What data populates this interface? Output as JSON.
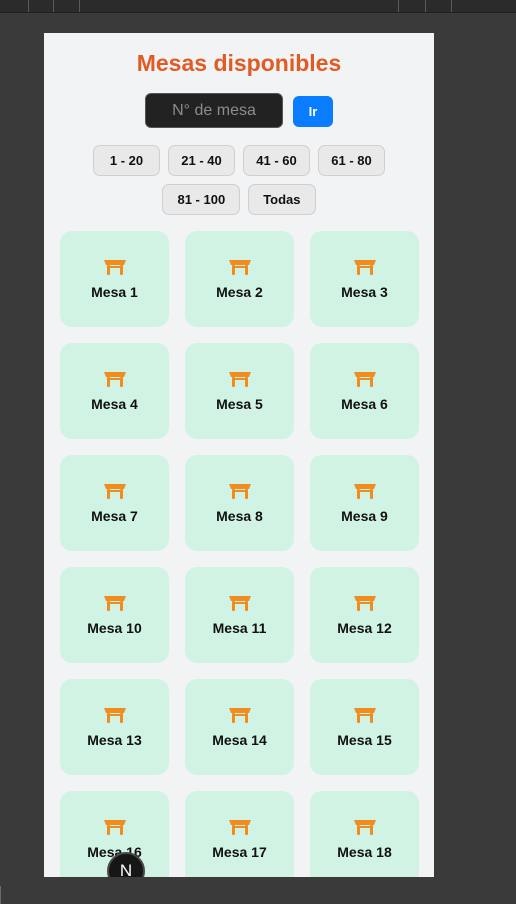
{
  "page": {
    "title": "Mesas disponibles",
    "search": {
      "placeholder": "N° de mesa",
      "value": ""
    },
    "go_label": "Ir"
  },
  "ranges": [
    "1 - 20",
    "21 - 40",
    "41 - 60",
    "61 - 80",
    "81 - 100",
    "Todas"
  ],
  "tables": [
    "Mesa 1",
    "Mesa 2",
    "Mesa 3",
    "Mesa 4",
    "Mesa 5",
    "Mesa 6",
    "Mesa 7",
    "Mesa 8",
    "Mesa 9",
    "Mesa 10",
    "Mesa 11",
    "Mesa 12",
    "Mesa 13",
    "Mesa 14",
    "Mesa 15",
    "Mesa 16",
    "Mesa 17",
    "Mesa 18"
  ],
  "icons": {
    "table": "table-icon"
  },
  "colors": {
    "title": "#e15b24",
    "go_button": "#0a7cff",
    "card_background": "#d1f3e3",
    "table_icon": "#f28c1e"
  },
  "dev_badge": {
    "letter": "N"
  }
}
